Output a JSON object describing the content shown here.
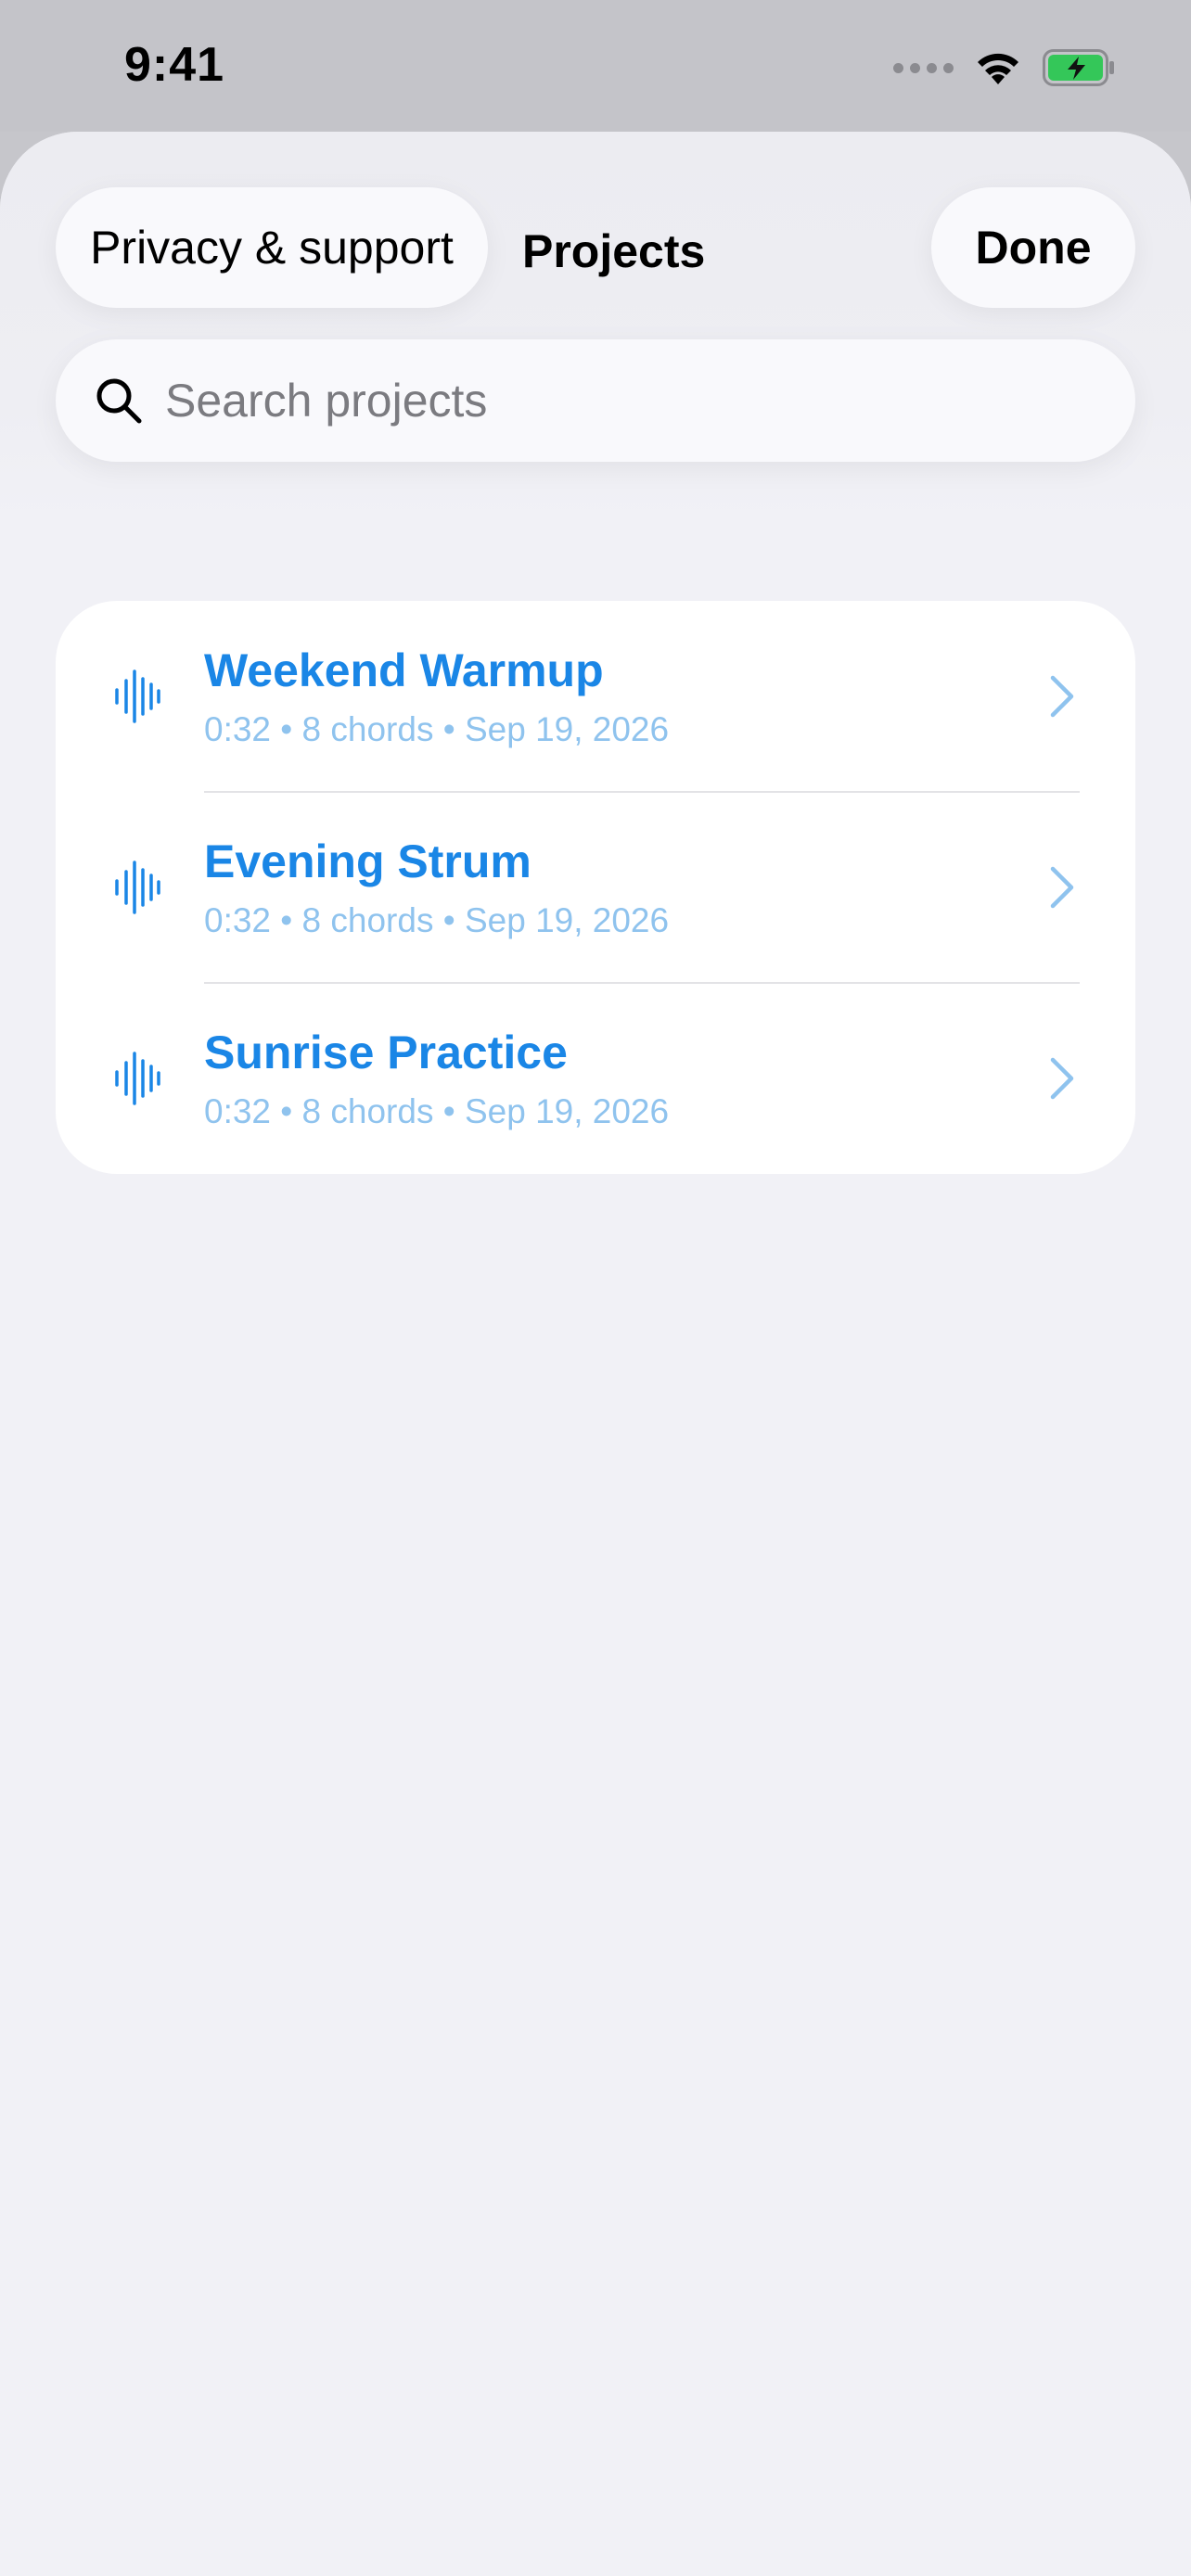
{
  "status_bar": {
    "time": "9:41"
  },
  "header": {
    "privacy_label": "Privacy & support",
    "title": "Projects",
    "done_label": "Done"
  },
  "search": {
    "placeholder": "Search projects",
    "value": ""
  },
  "projects": [
    {
      "title": "Weekend Warmup",
      "subtitle": "0:32 • 8 chords • Sep 19, 2026",
      "icon": "waveform-icon"
    },
    {
      "title": "Evening Strum",
      "subtitle": "0:32 • 8 chords • Sep 19, 2026",
      "icon": "waveform-icon"
    },
    {
      "title": "Sunrise Practice",
      "subtitle": "0:32 • 8 chords • Sep 19, 2026",
      "icon": "waveform-icon"
    }
  ],
  "colors": {
    "accent": "#1a86e6",
    "subtitle": "#8fc3ee",
    "sheet_background": "#f1f1f6",
    "battery_green": "#34c759"
  }
}
